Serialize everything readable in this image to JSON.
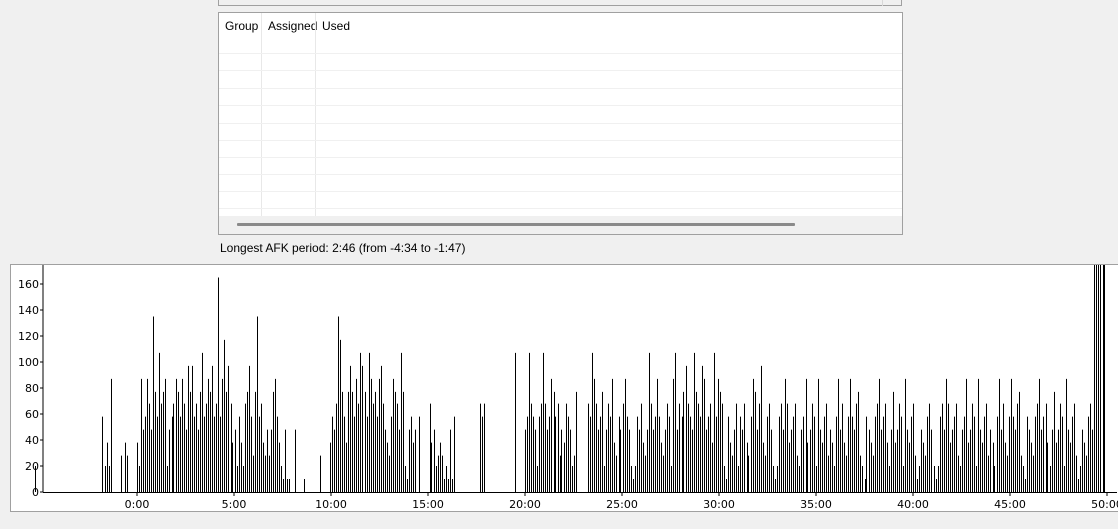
{
  "table": {
    "columns": [
      {
        "label": "Group"
      },
      {
        "label": "Assigned"
      },
      {
        "label": "Used"
      }
    ],
    "rows": []
  },
  "afk_text": "Longest AFK period: 2:46 (from -4:34 to -1:47)",
  "chart_data": {
    "type": "bar",
    "title": "",
    "xlabel": "",
    "ylabel": "",
    "ylim": [
      0,
      170
    ],
    "xlim": [
      -5.6,
      50.5
    ],
    "y_ticks": [
      0,
      20,
      40,
      60,
      80,
      100,
      120,
      140,
      160
    ],
    "x_ticks": [
      {
        "v": 0,
        "label": "0:00"
      },
      {
        "v": 5,
        "label": "5:00"
      },
      {
        "v": 10,
        "label": "10:00"
      },
      {
        "v": 15,
        "label": "15:00"
      },
      {
        "v": 20,
        "label": "20:00"
      },
      {
        "v": 25,
        "label": "25:00"
      },
      {
        "v": 30,
        "label": "30:00"
      },
      {
        "v": 35,
        "label": "35:00"
      },
      {
        "v": 40,
        "label": "40:00"
      },
      {
        "v": 45,
        "label": "45:00"
      },
      {
        "v": 50,
        "label": "50:00"
      }
    ],
    "bar_color": "#000000",
    "grid": false,
    "x": [
      -5.25,
      -1.78,
      -1.67,
      -1.57,
      -1.46,
      -1.36,
      -0.84,
      -0.63,
      -0.52,
      0.0,
      0.1,
      0.21,
      0.31,
      0.42,
      0.52,
      0.63,
      0.73,
      0.84,
      0.94,
      1.05,
      1.15,
      1.26,
      1.36,
      1.46,
      1.57,
      1.67,
      1.78,
      1.88,
      1.99,
      2.09,
      2.2,
      2.3,
      2.41,
      2.51,
      2.62,
      2.72,
      2.83,
      2.93,
      3.04,
      3.14,
      3.25,
      3.35,
      3.46,
      3.56,
      3.66,
      3.77,
      3.87,
      3.98,
      4.08,
      4.19,
      4.29,
      4.4,
      4.5,
      4.61,
      4.71,
      4.82,
      4.92,
      5.03,
      5.13,
      5.24,
      5.34,
      5.45,
      5.55,
      5.65,
      5.76,
      5.86,
      5.97,
      6.07,
      6.18,
      6.28,
      6.39,
      6.49,
      6.6,
      6.7,
      6.81,
      6.91,
      7.02,
      7.12,
      7.23,
      7.33,
      7.43,
      7.54,
      7.64,
      7.75,
      7.85,
      8.17,
      8.59,
      9.42,
      9.95,
      10.05,
      10.16,
      10.26,
      10.37,
      10.47,
      10.58,
      10.68,
      10.79,
      10.89,
      10.99,
      11.1,
      11.2,
      11.31,
      11.41,
      11.52,
      11.62,
      11.73,
      11.83,
      11.94,
      12.04,
      12.15,
      12.25,
      12.36,
      12.46,
      12.57,
      12.67,
      12.77,
      12.88,
      12.98,
      13.09,
      13.19,
      13.3,
      13.4,
      13.51,
      13.61,
      13.72,
      13.82,
      13.93,
      14.03,
      14.14,
      14.24,
      14.35,
      14.55,
      15.08,
      15.18,
      15.29,
      15.39,
      15.5,
      15.6,
      15.71,
      15.81,
      15.92,
      16.02,
      16.13,
      16.23,
      16.34,
      17.7,
      17.8,
      17.91,
      19.48,
      20.0,
      20.1,
      20.21,
      20.31,
      20.42,
      20.52,
      20.63,
      20.73,
      20.84,
      20.94,
      21.05,
      21.15,
      21.26,
      21.36,
      21.47,
      21.57,
      21.68,
      21.78,
      21.88,
      21.99,
      22.09,
      22.2,
      22.3,
      22.41,
      22.51,
      22.62,
      23.25,
      23.35,
      23.46,
      23.56,
      23.67,
      23.77,
      23.88,
      23.98,
      24.09,
      24.19,
      24.29,
      24.4,
      24.5,
      24.61,
      24.71,
      24.82,
      24.92,
      25.03,
      25.13,
      25.24,
      25.34,
      25.45,
      25.55,
      25.66,
      25.76,
      25.87,
      25.97,
      26.08,
      26.18,
      26.28,
      26.39,
      26.49,
      26.6,
      26.7,
      26.81,
      26.91,
      27.02,
      27.12,
      27.23,
      27.33,
      27.44,
      27.54,
      27.65,
      27.75,
      27.86,
      27.96,
      28.07,
      28.17,
      28.28,
      28.38,
      28.48,
      28.59,
      28.69,
      28.8,
      28.9,
      29.01,
      29.11,
      29.22,
      29.32,
      29.43,
      29.53,
      29.64,
      29.74,
      29.85,
      29.95,
      30.06,
      30.16,
      30.27,
      30.37,
      30.48,
      30.58,
      30.69,
      30.79,
      30.89,
      31.0,
      31.1,
      31.21,
      31.31,
      31.42,
      31.52,
      31.63,
      31.73,
      31.84,
      31.94,
      32.05,
      32.15,
      32.26,
      32.36,
      32.47,
      32.57,
      32.68,
      32.78,
      32.89,
      32.99,
      33.1,
      33.2,
      33.3,
      33.41,
      33.51,
      33.62,
      33.72,
      33.83,
      33.93,
      34.04,
      34.14,
      34.25,
      34.35,
      34.46,
      34.56,
      34.67,
      34.77,
      34.88,
      34.98,
      35.09,
      35.19,
      35.3,
      35.4,
      35.51,
      35.61,
      35.71,
      35.82,
      35.92,
      36.03,
      36.13,
      36.24,
      36.34,
      36.45,
      36.55,
      36.66,
      36.76,
      36.87,
      36.97,
      37.08,
      37.18,
      37.29,
      37.39,
      37.5,
      37.6,
      37.71,
      37.81,
      37.92,
      38.02,
      38.12,
      38.23,
      38.33,
      38.44,
      38.54,
      38.65,
      38.75,
      38.86,
      38.96,
      39.07,
      39.17,
      39.28,
      39.38,
      39.49,
      39.59,
      39.7,
      39.8,
      39.91,
      40.01,
      40.12,
      40.22,
      40.32,
      40.43,
      40.53,
      40.64,
      40.74,
      40.85,
      40.95,
      41.06,
      41.16,
      41.27,
      41.37,
      41.48,
      41.58,
      41.69,
      41.79,
      41.9,
      42.0,
      42.11,
      42.21,
      42.32,
      42.42,
      42.52,
      42.63,
      42.73,
      42.84,
      42.94,
      43.05,
      43.15,
      43.26,
      43.36,
      43.47,
      43.57,
      43.68,
      43.78,
      43.89,
      43.99,
      44.1,
      44.2,
      44.31,
      44.41,
      44.52,
      44.62,
      44.73,
      44.83,
      44.94,
      45.04,
      45.15,
      45.25,
      45.36,
      45.46,
      45.57,
      45.67,
      45.78,
      45.88,
      45.99,
      46.09,
      46.2,
      46.3,
      46.41,
      46.51,
      46.62,
      46.72,
      46.83,
      46.93,
      47.04,
      47.14,
      47.25,
      47.35,
      47.46,
      47.56,
      47.67,
      47.77,
      47.88,
      47.98,
      48.09,
      48.19,
      48.3,
      48.4,
      48.51,
      48.61,
      48.72,
      48.82,
      48.93,
      49.03,
      49.14,
      49.24,
      49.35,
      49.45,
      49.56,
      49.66,
      49.77,
      49.87
    ],
    "values": [
      20,
      58,
      20,
      38,
      20,
      87,
      28,
      38,
      28,
      38,
      20,
      87,
      48,
      58,
      87,
      68,
      48,
      135,
      77,
      58,
      107,
      68,
      77,
      87,
      20,
      48,
      58,
      68,
      87,
      77,
      58,
      87,
      68,
      48,
      97,
      77,
      97,
      58,
      68,
      48,
      77,
      107,
      58,
      68,
      87,
      77,
      97,
      58,
      68,
      165,
      58,
      87,
      117,
      77,
      97,
      68,
      38,
      48,
      20,
      58,
      38,
      20,
      68,
      77,
      97,
      58,
      28,
      77,
      135,
      58,
      68,
      38,
      28,
      48,
      28,
      48,
      77,
      87,
      58,
      38,
      20,
      10,
      48,
      10,
      10,
      48,
      10,
      28,
      38,
      58,
      48,
      68,
      135,
      117,
      77,
      58,
      38,
      77,
      97,
      77,
      58,
      87,
      68,
      107,
      97,
      77,
      58,
      107,
      87,
      68,
      77,
      58,
      87,
      97,
      68,
      48,
      38,
      28,
      58,
      87,
      77,
      68,
      48,
      107,
      77,
      20,
      10,
      48,
      58,
      38,
      48,
      58,
      68,
      38,
      48,
      20,
      28,
      38,
      28,
      10,
      20,
      10,
      48,
      10,
      58,
      68,
      58,
      68,
      107,
      48,
      58,
      107,
      68,
      58,
      48,
      20,
      58,
      68,
      107,
      68,
      48,
      58,
      87,
      77,
      58,
      68,
      28,
      48,
      38,
      68,
      58,
      48,
      20,
      28,
      77,
      68,
      58,
      107,
      87,
      68,
      48,
      58,
      77,
      20,
      48,
      68,
      58,
      87,
      38,
      28,
      58,
      48,
      68,
      87,
      58,
      48,
      20,
      10,
      20,
      58,
      48,
      68,
      38,
      28,
      48,
      107,
      68,
      48,
      58,
      87,
      58,
      38,
      28,
      48,
      68,
      58,
      20,
      87,
      107,
      48,
      68,
      58,
      77,
      97,
      68,
      58,
      48,
      107,
      77,
      68,
      58,
      97,
      87,
      48,
      58,
      68,
      38,
      107,
      58,
      87,
      77,
      68,
      20,
      10,
      58,
      38,
      28,
      48,
      68,
      20,
      58,
      48,
      68,
      38,
      28,
      58,
      87,
      77,
      48,
      68,
      97,
      38,
      28,
      58,
      68,
      48,
      20,
      10,
      20,
      58,
      68,
      48,
      87,
      68,
      38,
      48,
      58,
      68,
      28,
      20,
      48,
      58,
      87,
      38,
      48,
      68,
      58,
      20,
      87,
      48,
      38,
      58,
      68,
      28,
      48,
      38,
      20,
      58,
      87,
      48,
      68,
      38,
      28,
      58,
      87,
      58,
      48,
      68,
      77,
      28,
      20,
      10,
      58,
      48,
      38,
      28,
      58,
      68,
      87,
      48,
      58,
      68,
      38,
      20,
      48,
      77,
      38,
      48,
      68,
      58,
      20,
      87,
      48,
      38,
      58,
      68,
      28,
      10,
      20,
      48,
      38,
      28,
      58,
      68,
      48,
      20,
      10,
      20,
      58,
      68,
      48,
      87,
      68,
      38,
      48,
      58,
      68,
      28,
      20,
      48,
      58,
      87,
      38,
      48,
      68,
      58,
      20,
      87,
      48,
      38,
      58,
      68,
      28,
      48,
      38,
      20,
      58,
      87,
      48,
      68,
      38,
      28,
      58,
      87,
      58,
      48,
      68,
      77,
      28,
      20,
      10,
      58,
      48,
      38,
      28,
      58,
      68,
      87,
      48,
      58,
      68,
      38,
      20,
      48,
      77,
      38,
      48,
      68,
      58,
      20,
      87,
      48,
      38,
      58,
      68,
      28,
      10,
      20,
      48,
      38,
      28,
      58,
      68,
      48
    ]
  }
}
